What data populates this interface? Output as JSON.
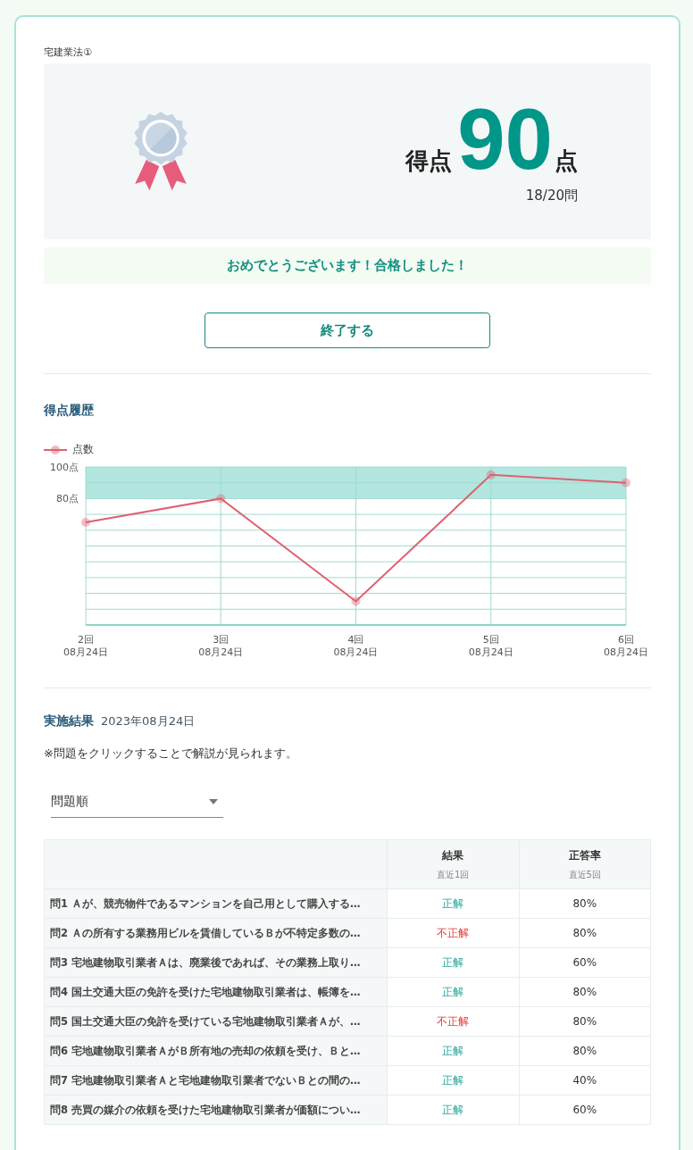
{
  "exam_title": "宅建業法①",
  "score": {
    "label": "得点",
    "value": "90",
    "unit": "点",
    "count": "18/20問",
    "passed": true
  },
  "message": "おめでとうございます！合格しました！",
  "finish_button": "終了する",
  "history": {
    "title": "得点履歴",
    "chart_data": {
      "type": "line",
      "categories": [
        "2回 08月24日",
        "3回 08月24日",
        "4回 08月24日",
        "5回 08月24日",
        "6回 08月24日"
      ],
      "series": [
        {
          "name": "点数",
          "color": "#e06070",
          "marker": "circle",
          "values": [
            65,
            80,
            15,
            95,
            90
          ]
        }
      ],
      "ylim": [
        0,
        100
      ],
      "yticks": [
        {
          "value": 80,
          "label": "80点"
        },
        {
          "value": 100,
          "label": "100点"
        }
      ],
      "bands": [
        {
          "axis": "y",
          "from": 80,
          "to": 100
        }
      ],
      "grid": true
    }
  },
  "results": {
    "title": "実施結果",
    "date": "2023年08月24日",
    "note": "※問題をクリックすることで解説が見られます。",
    "sort_select": "問題順",
    "columns": [
      {
        "label": "結果",
        "sub": "直近1回"
      },
      {
        "label": "正答率",
        "sub": "直近5回"
      }
    ],
    "rows": [
      {
        "question": "問1 Ａが、競売物件であるマンションを自己用として購入する…",
        "result": "正解",
        "correct": true,
        "rate": "80%"
      },
      {
        "question": "問2 Ａの所有する業務用ビルを賃借しているＢが不特定多数の…",
        "result": "不正解",
        "correct": false,
        "rate": "80%"
      },
      {
        "question": "問3 宅地建物取引業者Ａは、廃業後であれば、その業務上取り…",
        "result": "正解",
        "correct": true,
        "rate": "60%"
      },
      {
        "question": "問4 国土交通大臣の免許を受けた宅地建物取引業者は、帳簿を…",
        "result": "正解",
        "correct": true,
        "rate": "80%"
      },
      {
        "question": "問5 国土交通大臣の免許を受けている宅地建物取引業者Ａが、…",
        "result": "不正解",
        "correct": false,
        "rate": "80%"
      },
      {
        "question": "問6 宅地建物取引業者ＡがＢ所有地の売却の依頼を受け、Ｂと…",
        "result": "正解",
        "correct": true,
        "rate": "80%"
      },
      {
        "question": "問7 宅地建物取引業者Ａと宅地建物取引業者でないＢとの間の…",
        "result": "正解",
        "correct": true,
        "rate": "40%"
      },
      {
        "question": "問8 売買の媒介の依頼を受けた宅地建物取引業者が価額につい…",
        "result": "正解",
        "correct": true,
        "rate": "60%"
      }
    ]
  }
}
